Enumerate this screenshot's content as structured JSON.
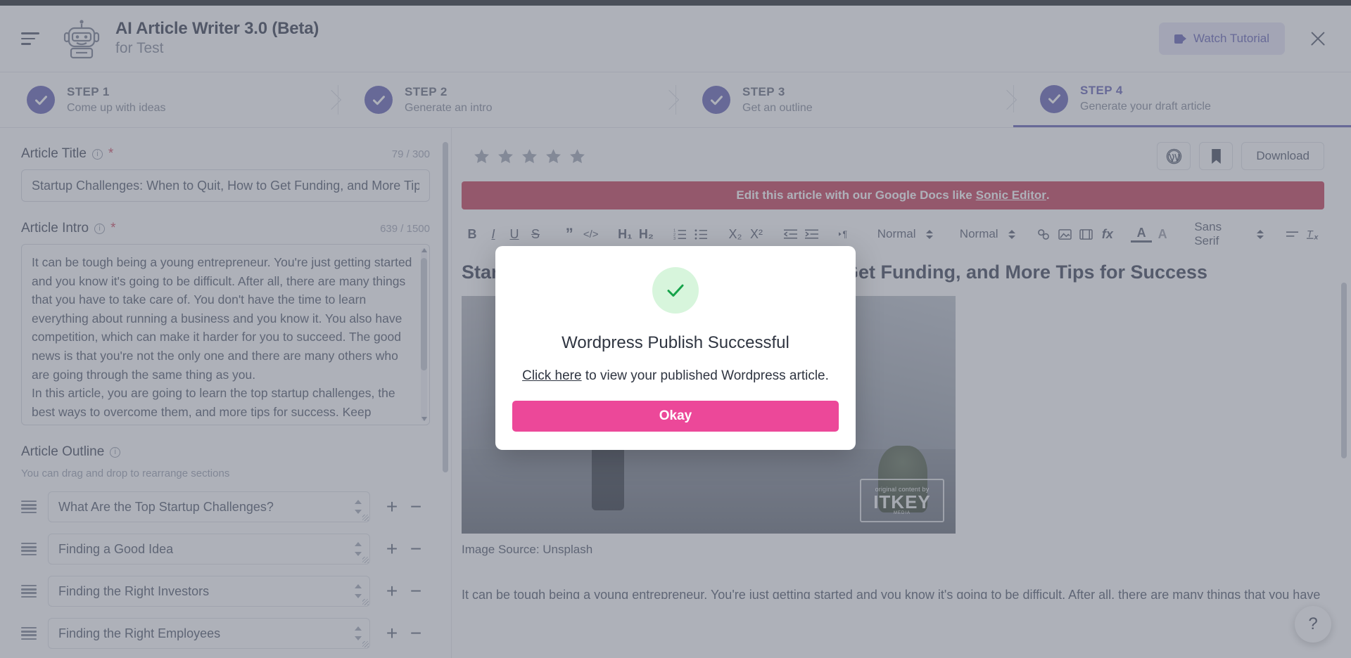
{
  "header": {
    "menu_icon": "hamburger-icon",
    "logo_icon": "robot-icon",
    "title": "AI Article Writer 3.0 (Beta)",
    "subtitle": "for Test",
    "watch_tutorial_label": "Watch Tutorial",
    "close_icon": "close-icon"
  },
  "steps": [
    {
      "label": "STEP 1",
      "desc": "Come up with ideas",
      "active": false
    },
    {
      "label": "STEP 2",
      "desc": "Generate an intro",
      "active": false
    },
    {
      "label": "STEP 3",
      "desc": "Get an outline",
      "active": false
    },
    {
      "label": "STEP 4",
      "desc": "Generate your draft article",
      "active": true
    }
  ],
  "left_panel": {
    "article_title": {
      "label": "Article Title",
      "required_mark": "*",
      "counter": "79 / 300",
      "value": "Startup Challenges: When to Quit, How to Get Funding, and More Tips"
    },
    "article_intro": {
      "label": "Article Intro",
      "required_mark": "*",
      "counter": "639 / 1500",
      "value": "It can be tough being a young entrepreneur. You're just getting started and you know it's going to be difficult. After all, there are many things that you have to take care of. You don't have the time to learn everything about running a business and you know it. You also have competition, which can make it harder for you to succeed. The good news is that you're not the only one and there are many others who are going through the same thing as you.\nIn this article, you are going to learn the top startup challenges, the best ways to overcome them, and more tips for success. Keep reading to learn more about this topic, your friends at"
    },
    "article_outline": {
      "label": "Article Outline",
      "hint": "You can drag and drop to rearrange sections",
      "items": [
        "What Are the Top Startup Challenges?",
        "Finding a Good Idea",
        "Finding the Right Investors",
        "Finding the Right Employees"
      ],
      "add_label": "+",
      "remove_label": "−"
    }
  },
  "right_panel": {
    "rating_stars": 5,
    "wordpress_icon": "wordpress-icon",
    "bookmark_icon": "bookmark-icon",
    "download_label": "Download",
    "banner": {
      "text_before": "Edit this article with our Google Docs like",
      "link_text": "Sonic Editor",
      "text_after": "."
    },
    "toolbar": {
      "bold": "B",
      "italic": "I",
      "underline": "U",
      "strike": "S",
      "blockquote": "”",
      "code": "</>",
      "h1": "H₁",
      "h2": "H₂",
      "ordered_list": "ordered-list-icon",
      "bullet_list": "bullet-list-icon",
      "subscript": "X₂",
      "superscript": "X²",
      "outdent": "outdent-icon",
      "indent": "indent-icon",
      "direction": "text-direction-icon",
      "style_select": "Normal",
      "size_select": "Normal",
      "link": "link-icon",
      "image": "image-icon",
      "video": "video-icon",
      "formula": "fx",
      "text_color": "A",
      "highlight": "A",
      "font_select": "Sans Serif",
      "align": "align-icon",
      "clear_format": "clear-format-icon"
    },
    "document": {
      "title": "Startup Challenges: When to Quit, How to Get Funding, and More Tips for Success",
      "watermark_top": "original content by",
      "watermark_main": "ITKEY",
      "watermark_sub": "MEDIA",
      "image_caption": "Image Source: Unsplash",
      "paragraph": "It can be tough being a young entrepreneur. You're just getting started and you know it's going to be difficult. After all, there are many things that you have to take care of. You don't have the time to learn everything about running a business and you know it. You also have competition, which can make it harder for you to succeed. The good news is that you're not the only one and there are many others who are going through the same thing"
    }
  },
  "help_button_label": "?",
  "modal": {
    "check_icon": "check-circle-icon",
    "title": "Wordpress Publish Successful",
    "link_text": "Click here",
    "body_text": "to view your published Wordpress article.",
    "okay_label": "Okay",
    "accent_color": "#ec4899",
    "success_color": "#16a34a"
  }
}
